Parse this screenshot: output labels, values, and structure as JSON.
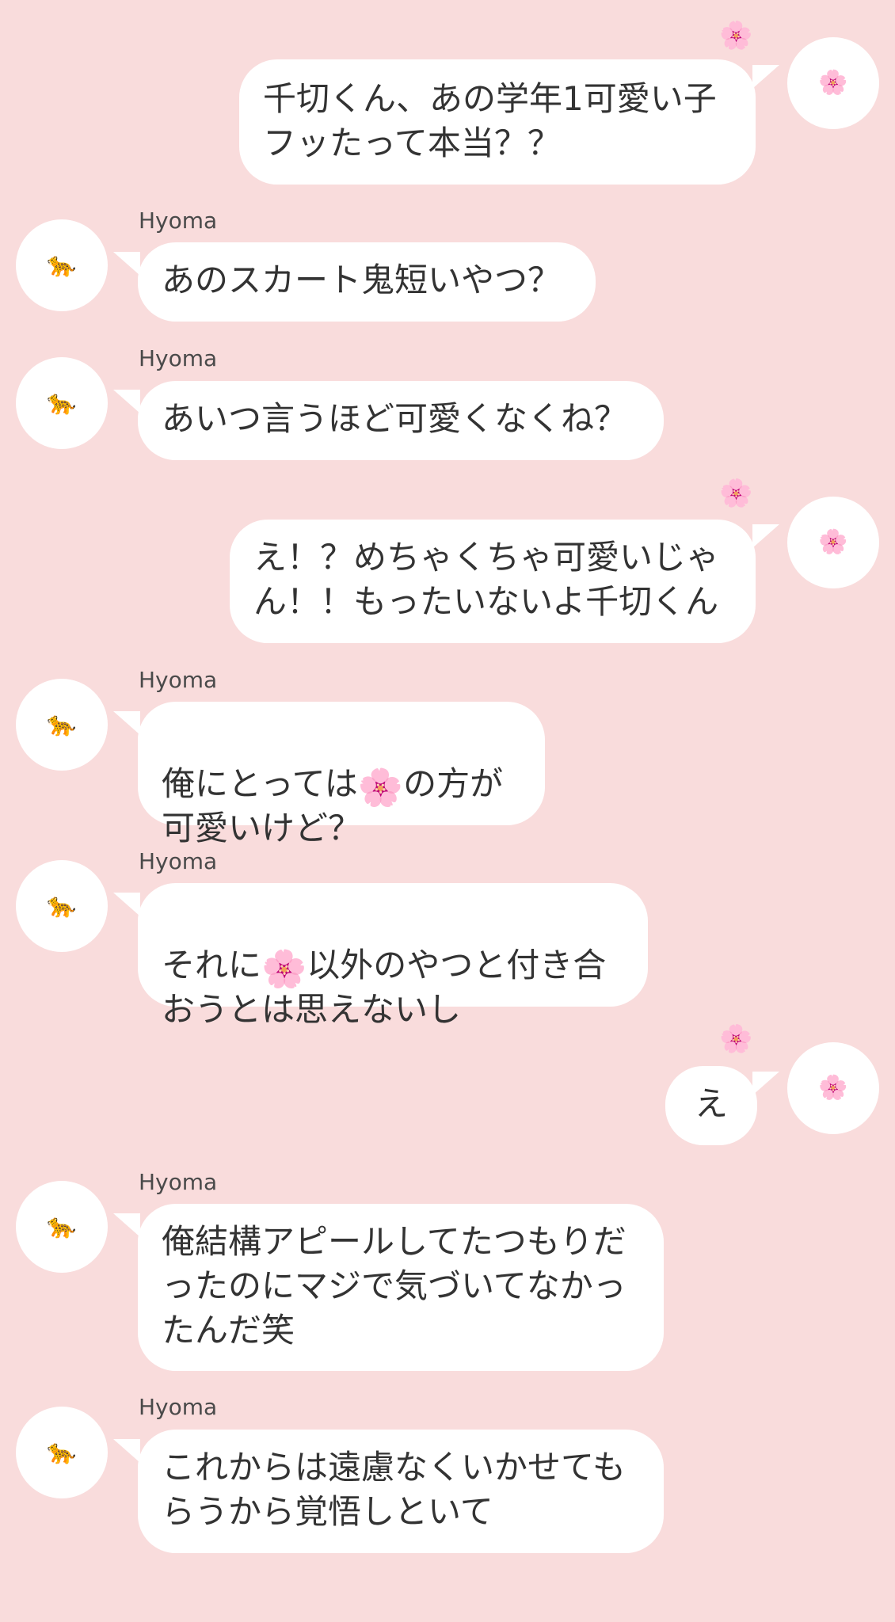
{
  "colors": {
    "background": "#f9dcdc",
    "bubble": "#ffffff",
    "text": "#333333",
    "name": "#4a4a4a"
  },
  "icons": {
    "me": "cherry-blossom-icon",
    "other": "leopard-icon"
  },
  "glyphs": {
    "blossom": "🌸",
    "leopard": "🐆"
  },
  "messages": [
    {
      "side": "right",
      "text": "千切くん、あの学年1可愛い子\nフッたって本当？？",
      "reaction": "🌸"
    },
    {
      "side": "left",
      "sender": "Hyoma",
      "text": "あのスカート鬼短いやつ？"
    },
    {
      "side": "left",
      "sender": "Hyoma",
      "text": "あいつ言うほど可愛くなくね？"
    },
    {
      "side": "right",
      "text": "え！？めちゃくちゃ可愛いじゃ\nん！！もったいないよ千切くん",
      "reaction": "🌸"
    },
    {
      "side": "left",
      "sender": "Hyoma",
      "parts": [
        "俺にとっては",
        "の方が\n可愛いけど？"
      ]
    },
    {
      "side": "left",
      "sender": "Hyoma",
      "parts": [
        "それに",
        "以外のやつと付き合\nおうとは思えないし"
      ]
    },
    {
      "side": "right",
      "text": "え",
      "reaction": "🌸"
    },
    {
      "side": "left",
      "sender": "Hyoma",
      "text": "俺結構アピールしてたつもりだ\nったのにマジで気づいてなかっ\nたんだ笑"
    },
    {
      "side": "left",
      "sender": "Hyoma",
      "text": "これからは遠慮なくいかせても\nらうから覚悟しといて"
    }
  ]
}
